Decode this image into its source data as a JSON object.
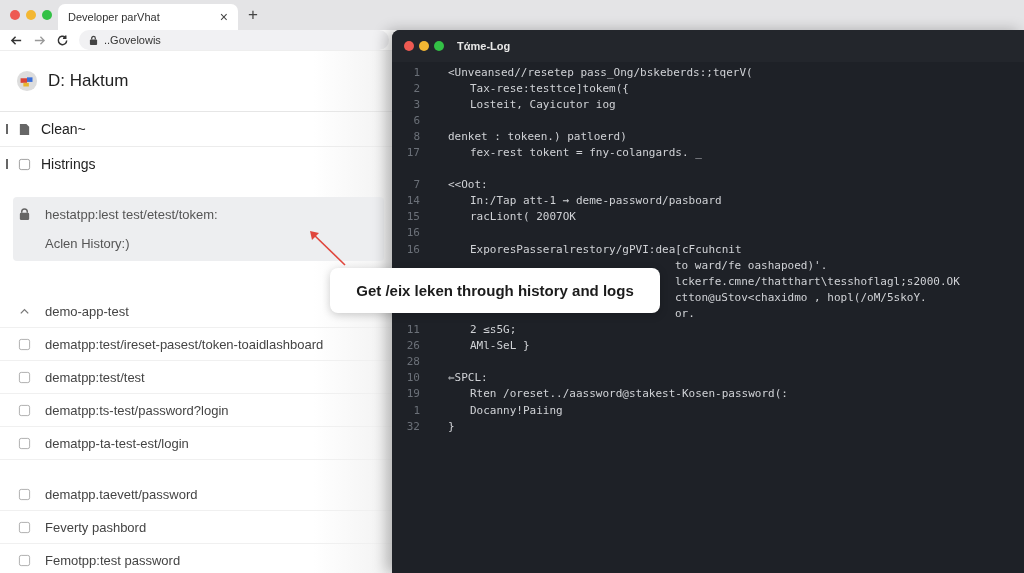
{
  "browser": {
    "tab_title": "Developer parVhat",
    "new_tab": "+",
    "close": "×",
    "url": "..Govelowis"
  },
  "sidebar": {
    "title": "D: Haktum",
    "top_items": [
      {
        "label": "Clean",
        "kind": "doc",
        "caret": "~"
      },
      {
        "label": "Histrings",
        "kind": "box",
        "checked": false
      }
    ],
    "card": {
      "path": "hestatpp:lest test/etest/tokem:",
      "subtitle": "Aclen History:)"
    },
    "item_groups": [
      {
        "items": [
          {
            "label": "demo-app-test",
            "kind": "caret"
          },
          {
            "label": "dematpp:test/ireset-pasest/token-toaidlashboard",
            "kind": "box",
            "checked": false
          },
          {
            "label": "dematpp:test/test",
            "kind": "box",
            "checked": false
          },
          {
            "label": "dematpp:ts-test/password?login",
            "kind": "box",
            "checked": false
          },
          {
            "label": "dematpp-ta-test-est/login",
            "kind": "box",
            "checked": false
          }
        ]
      },
      {
        "items": [
          {
            "label": "dematpp.taevett/password",
            "kind": "box",
            "checked": false
          },
          {
            "label": "Feverty pashbord",
            "kind": "box",
            "checked": false
          },
          {
            "label": "Femotpp:test password",
            "kind": "box",
            "checked": false
          }
        ]
      }
    ]
  },
  "log_window": {
    "title": "Tάme-Log",
    "lines": [
      {
        "kind": "top",
        "number": "1",
        "text": "<Unveansed//resetep pass_Ong/bskeberds:;tqerV("
      },
      {
        "kind": "nested",
        "number": "2",
        "text": "Tax-rese:testtce]tokem({"
      },
      {
        "kind": "nested",
        "number": "3",
        "text": "Losteit, Cayicutor iog"
      },
      {
        "kind": "blank",
        "number": "6"
      },
      {
        "kind": "top",
        "number": "8",
        "text": "denket : tokeen.) patloerd)"
      },
      {
        "kind": "nested",
        "number": "17",
        "text": "fex-rest tokent = fny-colangards. _"
      },
      {
        "kind": "blank"
      },
      {
        "kind": "top",
        "number": "7",
        "text": "<<Oot:"
      },
      {
        "kind": "nested",
        "number": "14",
        "text": "In:/Tap att-1 → deme-password/pasboard"
      },
      {
        "kind": "nested",
        "number": "15",
        "text": "racLiont( 2007OK"
      },
      {
        "kind": "blank",
        "number": "16"
      },
      {
        "kind": "nested",
        "number": "16",
        "text": "ExporesPasseralrestory/gPVI:dea[cFcuhcnit"
      },
      {
        "kind": "tail",
        "text": "to ward/fe oashapoed)'."
      },
      {
        "kind": "tail",
        "text": "lckerfe.cmne/thatthart\\tesshoflagl;s2000.OK"
      },
      {
        "kind": "tail",
        "text": "ctton@uStov<chaxidmo , hopl(/oM/5skoY."
      },
      {
        "kind": "tail",
        "text": "or."
      },
      {
        "kind": "nested",
        "number": "11",
        "text": "2 ≤s5G;"
      },
      {
        "kind": "nested",
        "number": "26",
        "text": "AMl-SeL }"
      },
      {
        "kind": "blank",
        "number": "28"
      },
      {
        "kind": "top",
        "number": "10",
        "text": "⇐SPCL:"
      },
      {
        "kind": "nested",
        "number": "19",
        "text": "Rten /oreset../aassword@stakest-Kosen-password(:"
      },
      {
        "kind": "nested",
        "number": "1",
        "text": "Docanny!Paiing"
      },
      {
        "kind": "top",
        "number": "32",
        "text": "}"
      }
    ]
  },
  "callout": {
    "text": "Get /eix leken through history and logs"
  }
}
